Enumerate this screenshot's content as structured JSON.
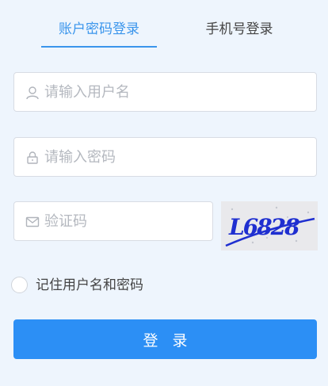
{
  "tabs": {
    "account_login": "账户密码登录",
    "phone_login": "手机号登录"
  },
  "form": {
    "username_placeholder": "请输入用户名",
    "password_placeholder": "请输入密码",
    "captcha_placeholder": "验证码",
    "captcha_text": "L6828",
    "remember_label": "记住用户名和密码",
    "login_label": "登 录"
  },
  "icons": {
    "username": "user-icon",
    "password": "lock-icon",
    "captcha": "envelope-icon"
  },
  "colors": {
    "accent": "#3a95ec",
    "button": "#2c8ff5",
    "background": "#eef5fd",
    "captcha_ink": "#1f2fd0"
  }
}
